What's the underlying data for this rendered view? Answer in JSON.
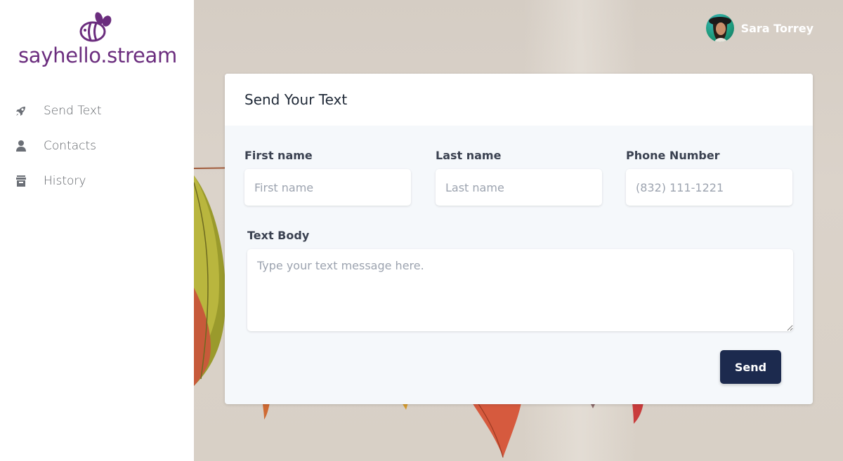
{
  "brand": {
    "name": "sayhello.stream",
    "color": "#6b2d7e",
    "icon": "bee-icon"
  },
  "sidebar": {
    "items": [
      {
        "label": "Send Text",
        "icon": "rocket-icon"
      },
      {
        "label": "Contacts",
        "icon": "user-icon"
      },
      {
        "label": "History",
        "icon": "archive-icon"
      }
    ]
  },
  "user": {
    "name": "Sara Torrey"
  },
  "form": {
    "title": "Send Your Text",
    "first_name": {
      "label": "First name",
      "placeholder": "First name",
      "value": ""
    },
    "last_name": {
      "label": "Last name",
      "placeholder": "Last name",
      "value": ""
    },
    "phone": {
      "label": "Phone Number",
      "placeholder": "(832) 111-1221",
      "value": ""
    },
    "body": {
      "label": "Text Body",
      "placeholder": "Type your text message here.",
      "value": ""
    },
    "submit_label": "Send"
  },
  "colors": {
    "button": "#1c2a4e",
    "card_body": "#f5f8fb",
    "nav_text": "#5f6368"
  }
}
